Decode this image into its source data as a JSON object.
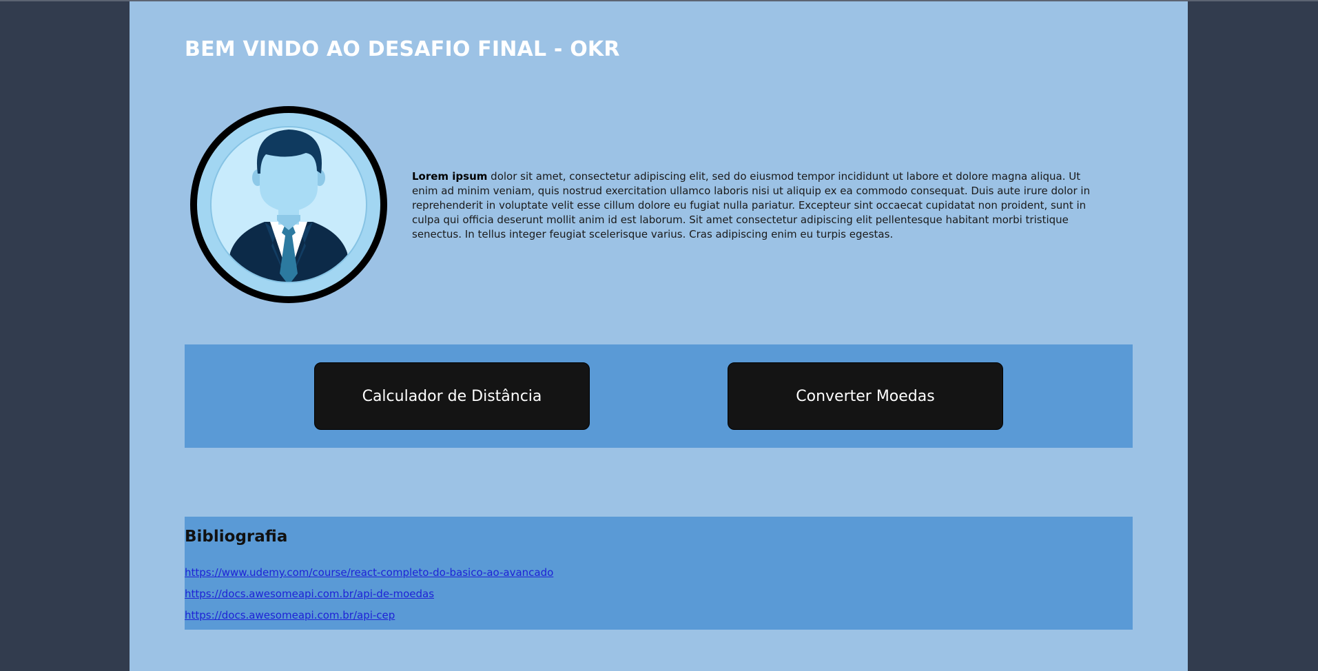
{
  "header": {
    "title": "BEM VINDO AO DESAFIO FINAL - OKR"
  },
  "profile": {
    "avatar_icon": "person-in-suit-avatar-icon",
    "intro_bold": "Lorem ipsum",
    "intro_text": " dolor sit amet, consectetur adipiscing elit, sed do eiusmod tempor incididunt ut labore et dolore magna aliqua. Ut enim ad minim veniam, quis nostrud exercitation ullamco laboris nisi ut aliquip ex ea commodo consequat. Duis aute irure dolor in reprehenderit in voluptate velit esse cillum dolore eu fugiat nulla pariatur. Excepteur sint occaecat cupidatat non proident, sunt in culpa qui officia deserunt mollit anim id est laborum. Sit amet consectetur adipiscing elit pellentesque habitant morbi tristique senectus. In tellus integer feugiat scelerisque varius. Cras adipiscing enim eu turpis egestas."
  },
  "actions": {
    "distance_label": "Calculador de Distância",
    "currency_label": "Converter Moedas"
  },
  "bibliography": {
    "heading": "Bibliografia",
    "links": [
      "https://www.udemy.com/course/react-completo-do-basico-ao-avancado",
      "https://docs.awesomeapi.com.br/api-de-moedas",
      "https://docs.awesomeapi.com.br/api-cep"
    ]
  },
  "colors": {
    "outer_background": "#323c4e",
    "page_background": "#9cc2e5",
    "band_background": "#5a9ad6",
    "button_background": "#141414",
    "link": "#1d23d6"
  }
}
